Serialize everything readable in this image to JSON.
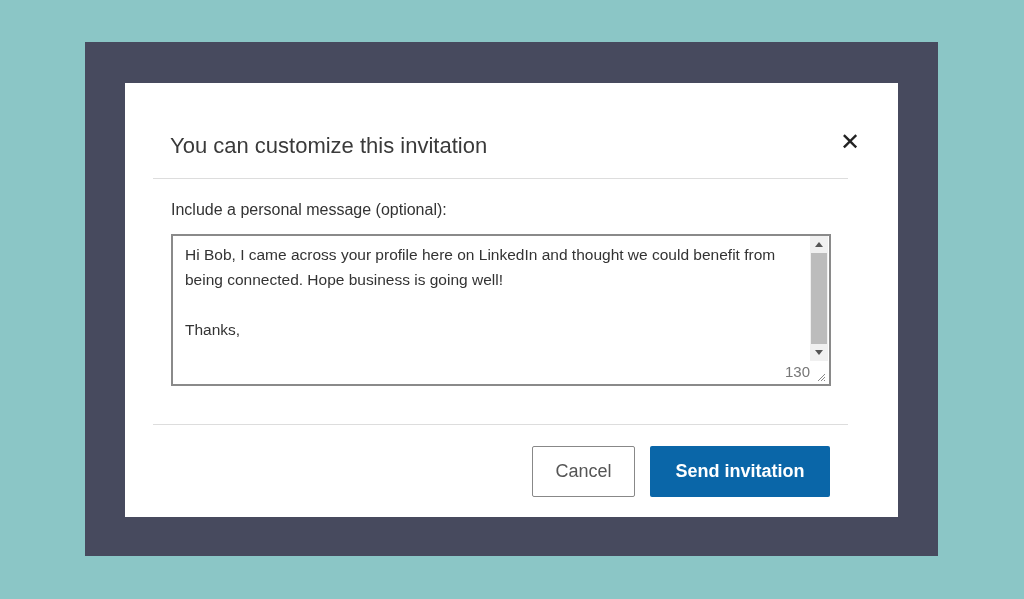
{
  "dialog": {
    "title": "You can customize this invitation",
    "close_icon": "✕",
    "message_label": "Include a personal message (optional):",
    "message": {
      "value": "Hi Bob, I came across your profile here on LinkedIn and thought we could benefit from being connected. Hope business is going well!\n\nThanks,",
      "counter": "130"
    },
    "buttons": [
      {
        "label": "Cancel",
        "kind": "secondary"
      },
      {
        "label": "Send invitation",
        "kind": "primary"
      }
    ]
  }
}
